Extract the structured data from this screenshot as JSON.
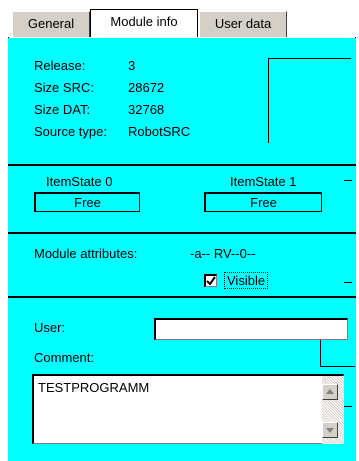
{
  "tabs": [
    "General",
    "Module info",
    "User data"
  ],
  "module_info": {
    "release_label": "Release:",
    "release_value": "3",
    "size_src_label": "Size SRC:",
    "size_src_value": "28672",
    "size_dat_label": "Size DAT:",
    "size_dat_value": "32768",
    "source_type_label": "Source type:",
    "source_type_value": "RobotSRC"
  },
  "item_states": {
    "state0_label": "ItemState 0",
    "state0_value": "Free",
    "state1_label": "ItemState 1",
    "state1_value": "Free"
  },
  "attributes": {
    "label": "Module attributes:",
    "value": "-a-- RV--0--",
    "visible_label": "Visible",
    "visible_checked": true
  },
  "user_data": {
    "user_label": "User:",
    "user_value": "",
    "comment_label": "Comment:",
    "comment_value": "TESTPROGRAMM"
  },
  "colors": {
    "panel": "#00ffff",
    "tab": "#d4d0c8"
  },
  "icons": [
    "scroll-up-icon",
    "scroll-down-icon",
    "check-icon"
  ]
}
